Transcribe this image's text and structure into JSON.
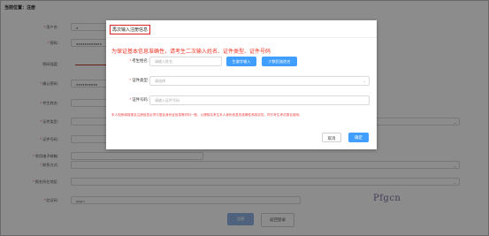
{
  "breadcrumb": "当前位置：注册",
  "background_form": {
    "rows": [
      {
        "label": "用户名",
        "required": true,
        "value": "●",
        "type": "input"
      },
      {
        "label": "密码",
        "required": true,
        "value": "●●●●●●●●●●●●",
        "type": "input"
      },
      {
        "label": "密码强度",
        "required": false,
        "value": "",
        "type": "strength"
      },
      {
        "label": "确认密码",
        "required": true,
        "value": "●●●●●●●●●●",
        "type": "input"
      },
      {
        "label": "考生姓名",
        "required": true,
        "value": "",
        "type": "input"
      },
      {
        "label": "证件类型",
        "required": true,
        "value": "",
        "type": "select"
      },
      {
        "label": "证件号码",
        "required": true,
        "value": "",
        "type": "input"
      },
      {
        "label": "常用电子邮箱",
        "required": true,
        "value": "",
        "type": "input"
      },
      {
        "label": "联系方式",
        "required": true,
        "value": "",
        "type": "select"
      },
      {
        "label": "报名所在地区",
        "required": true,
        "value": "",
        "type": "select"
      },
      {
        "label": "验证码",
        "required": true,
        "value": "pfgcn",
        "type": "captcha"
      }
    ],
    "captcha_image_text": "Pfgcn",
    "submit_label": "注册",
    "back_label": "返回登录"
  },
  "modal": {
    "title": "再次输入注册信息",
    "notice": "为保证基本信息准确性，请考生二次输入姓名、证件类型、证件号码",
    "name_label": "考生姓名",
    "name_placeholder": "请输入姓名",
    "btn_generate": "生僻字输入",
    "btn_no_name": "少数民族姓名",
    "id_type_label": "证件类型",
    "id_type_placeholder": "请选择",
    "id_number_label": "证件号码",
    "id_number_placeholder": "请输入证件号码",
    "footnote": "本人知悉填报报名注册信息必须与居民身份证信息等材料一致，以便核实考生本人身份信息的准确性和真实性，同于考生考试报名使用。",
    "cancel_label": "取消",
    "ok_label": "确定"
  },
  "colors": {
    "accent": "#409eff",
    "notice": "#ee3322",
    "title_border": "#dd2222"
  }
}
